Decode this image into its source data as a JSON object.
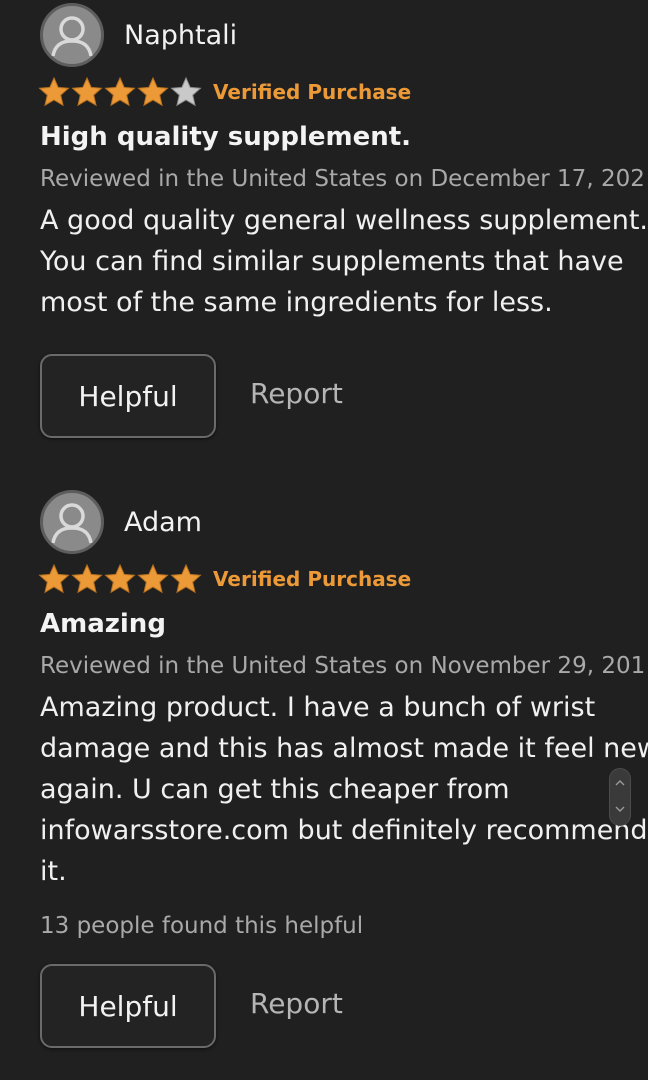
{
  "reviews": [
    {
      "name": "Naphtali",
      "rating": 4,
      "rating_max": 5,
      "verified_label": "Verified Purchase",
      "title": "High quality supplement.",
      "date_line": "Reviewed in the United States on December 17, 202",
      "body_lines": [
        "A good quality general wellness supplement.",
        "You can find similar supplements that have",
        "most of the same ingredients for less."
      ],
      "helpful_label": "Helpful",
      "report_label": "Report"
    },
    {
      "name": "Adam",
      "rating": 5,
      "rating_max": 5,
      "verified_label": "Verified Purchase",
      "title": "Amazing",
      "date_line": "Reviewed in the United States on November 29, 201",
      "body_lines": [
        "Amazing product. I have a bunch of wrist",
        "damage and this has almost made it feel new",
        "again. U can get this cheaper from",
        "infowarsstore.com but definitely recommend",
        "it."
      ],
      "helpful_count_text": "13 people found this helpful",
      "helpful_label": "Helpful",
      "report_label": "Report"
    }
  ],
  "colors": {
    "background": "#202020",
    "star_filled": "#ec9937",
    "star_empty": "#c9c9c9",
    "verified": "#ec9937",
    "secondary_text": "#a9a9a9"
  },
  "icons": {
    "avatar": "user-avatar-icon",
    "star": "star-icon",
    "scroll": "scroll-handle-icon"
  }
}
